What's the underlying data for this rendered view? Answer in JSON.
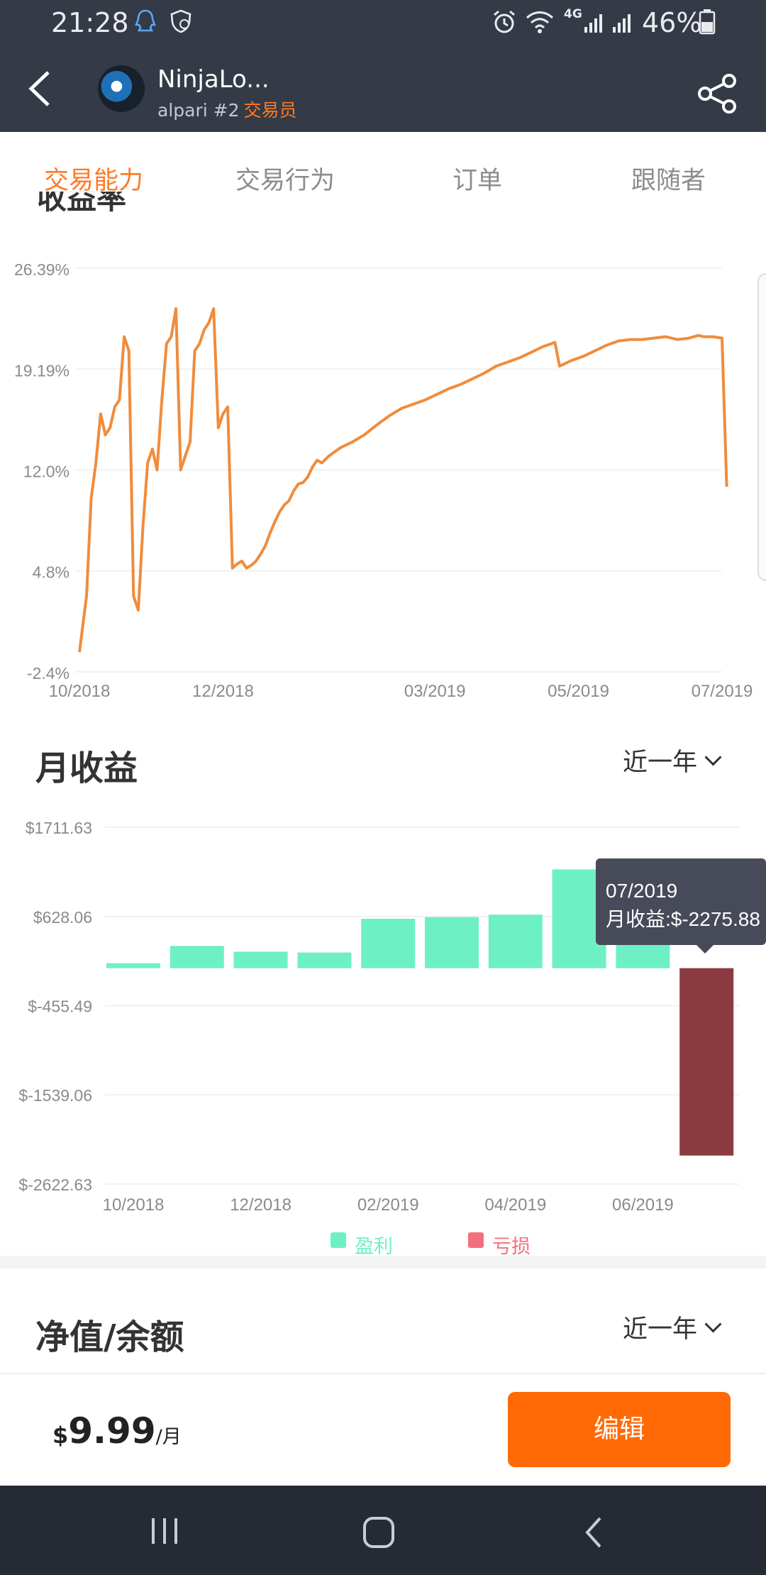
{
  "status_bar": {
    "time": "21:28",
    "network": "4G",
    "battery": "46%",
    "left_icons": [
      "qq-icon",
      "shield-icon"
    ],
    "right_icons": [
      "alarm-icon",
      "wifi-icon",
      "signal-icon",
      "signal-icon",
      "battery-icon"
    ]
  },
  "header": {
    "trader_name": "NinjaLo...",
    "server": "alpari #2",
    "role": "交易员"
  },
  "tabs": [
    "交易能力",
    "交易行为",
    "订单",
    "跟随者"
  ],
  "active_tab_index": 0,
  "yield_section": {
    "title": "收益率"
  },
  "yield_chart": {
    "type": "line",
    "color": "#f08c3c",
    "y_ticks": [
      "26.39%",
      "19.19%",
      "12.0%",
      "4.8%",
      "-2.4%"
    ],
    "x_ticks": [
      "10/2018",
      "12/2018",
      "03/2019",
      "05/2019",
      "07/2019"
    ]
  },
  "monthly_section": {
    "title": "月收益",
    "range": "近一年"
  },
  "tooltip": {
    "date": "07/2019",
    "text": "月收益:$-2275.88"
  },
  "legend": {
    "profit": "盈利",
    "loss": "亏损",
    "profit_color": "#6ef0c5",
    "loss_color": "#f2707e"
  },
  "equity_section": {
    "title": "净值/余额",
    "range": "近一年"
  },
  "footer": {
    "currency": "$",
    "price": "9.99",
    "unit": "/月",
    "edit_label": "编辑"
  },
  "chart_data": [
    {
      "type": "line",
      "title": "收益率",
      "x_range": [
        "2018-10-01",
        "2019-07-01"
      ],
      "ylim": [
        -2.4,
        26.39
      ],
      "y_unit": "%",
      "x_ticks": [
        "10/2018",
        "12/2018",
        "03/2019",
        "05/2019",
        "07/2019"
      ],
      "y_ticks": [
        "26.39%",
        "19.19%",
        "12.0%",
        "4.8%",
        "-2.4%"
      ],
      "series": [
        {
          "x": [
            "2018-10-01",
            "2018-10-04",
            "2018-10-06",
            "2018-10-08",
            "2018-10-10",
            "2018-10-12",
            "2018-10-14",
            "2018-10-16",
            "2018-10-18",
            "2018-10-20",
            "2018-10-22",
            "2018-10-24",
            "2018-10-26",
            "2018-10-28",
            "2018-10-30",
            "2018-11-01",
            "2018-11-03",
            "2018-11-05",
            "2018-11-07",
            "2018-11-09",
            "2018-11-11",
            "2018-11-13",
            "2018-11-15",
            "2018-11-17",
            "2018-11-19",
            "2018-11-21",
            "2018-11-23",
            "2018-11-25",
            "2018-11-27",
            "2018-11-29",
            "2018-12-01",
            "2018-12-03",
            "2018-12-05",
            "2018-12-07",
            "2018-12-09",
            "2018-12-11",
            "2018-12-13",
            "2018-12-15",
            "2018-12-17",
            "2018-12-19",
            "2018-12-21",
            "2018-12-23",
            "2018-12-25",
            "2018-12-27",
            "2018-12-29",
            "2018-12-31",
            "2019-01-02",
            "2019-01-04",
            "2019-01-06",
            "2019-01-08",
            "2019-01-10",
            "2019-01-12",
            "2019-01-15",
            "2019-01-20",
            "2019-01-25",
            "2019-01-30",
            "2019-02-05",
            "2019-02-10",
            "2019-02-15",
            "2019-02-20",
            "2019-02-25",
            "2019-03-02",
            "2019-03-07",
            "2019-03-12",
            "2019-03-17",
            "2019-03-22",
            "2019-03-27",
            "2019-04-01",
            "2019-04-06",
            "2019-04-11",
            "2019-04-16",
            "2019-04-21",
            "2019-04-23",
            "2019-04-28",
            "2019-05-03",
            "2019-05-08",
            "2019-05-13",
            "2019-05-18",
            "2019-05-23",
            "2019-05-28",
            "2019-06-02",
            "2019-06-07",
            "2019-06-12",
            "2019-06-17",
            "2019-06-21",
            "2019-06-23",
            "2019-06-27",
            "2019-07-01",
            "2019-07-03"
          ],
          "y": [
            -1.0,
            3.0,
            10.0,
            12.5,
            16.0,
            14.5,
            15.0,
            16.5,
            17.0,
            21.5,
            20.5,
            3.0,
            2.0,
            8.0,
            12.5,
            13.5,
            12.0,
            17.0,
            21.0,
            21.5,
            23.5,
            12.0,
            13.0,
            14.0,
            20.5,
            21.0,
            22.0,
            22.5,
            23.5,
            15.0,
            16.0,
            16.5,
            5.0,
            5.3,
            5.5,
            5.0,
            5.2,
            5.5,
            6.0,
            6.6,
            7.5,
            8.3,
            9.0,
            9.5,
            9.8,
            10.5,
            11.0,
            11.1,
            11.5,
            12.2,
            12.7,
            12.5,
            13.0,
            13.6,
            14.0,
            14.5,
            15.3,
            15.9,
            16.4,
            16.7,
            17.0,
            17.4,
            17.8,
            18.1,
            18.5,
            18.9,
            19.4,
            19.7,
            20.0,
            20.4,
            20.8,
            21.1,
            19.4,
            19.8,
            20.1,
            20.5,
            20.9,
            21.2,
            21.3,
            21.3,
            21.4,
            21.5,
            21.3,
            21.4,
            21.6,
            21.5,
            21.5,
            21.4,
            10.8
          ]
        }
      ]
    },
    {
      "type": "bar",
      "title": "月收益",
      "categories": [
        "10/2018",
        "11/2018",
        "12/2018",
        "01/2019",
        "02/2019",
        "03/2019",
        "04/2019",
        "05/2019",
        "06/2019",
        "07/2019"
      ],
      "x_ticks": [
        "10/2018",
        "12/2018",
        "02/2019",
        "04/2019",
        "06/2019"
      ],
      "values": [
        60,
        270,
        200,
        190,
        600,
        620,
        650,
        1200,
        1020,
        -2275.88
      ],
      "ylim": [
        -2622.63,
        1711.63
      ],
      "y_ticks": [
        "$1711.63",
        "$628.06",
        "$-455.49",
        "$-1539.06",
        "$-2622.63"
      ],
      "legend": [
        "盈利",
        "亏损"
      ],
      "legend_placement": "bottom"
    }
  ]
}
